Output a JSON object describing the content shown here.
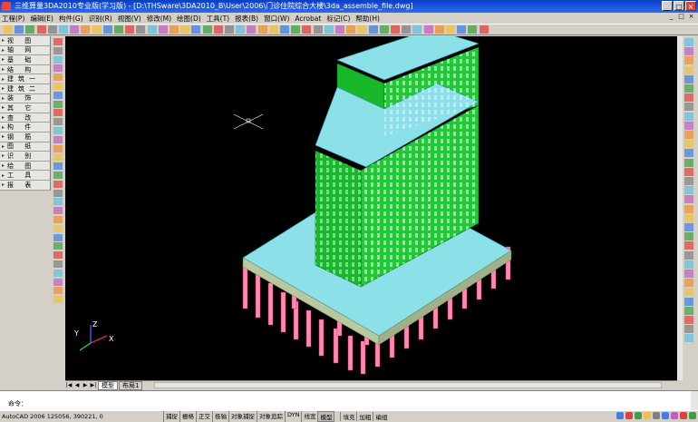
{
  "window": {
    "title": "三维算量3DA2010专业版(学习版) - [D:\\THSware\\3DA2010_B\\User\\2006\\门诊住院综合大楼\\3da_assemble_file.dwg]",
    "minimize": "_",
    "maximize": "□",
    "close": "×"
  },
  "menu": [
    "工程(P)",
    "编辑(E)",
    "构件(G)",
    "识别(R)",
    "视图(V)",
    "修改(M)",
    "绘图(D)",
    "工具(T)",
    "报表(B)",
    "窗口(W)",
    "Acrobat",
    "标记(C)",
    "帮助(H)"
  ],
  "menu_right": [
    "_",
    "□",
    "×"
  ],
  "left_menu": [
    "视  图",
    "轴  网",
    "基  础",
    "结  构",
    "建筑一",
    "建筑二",
    "装  饰",
    "其  它",
    "查  改",
    "构  件",
    "钢  筋",
    "图  纸",
    "识  别",
    "绘  图",
    "工  具",
    "报  表"
  ],
  "tabs": {
    "nav": [
      "|◀",
      "◀",
      "▶",
      "▶|"
    ],
    "items": [
      "模型",
      "布局1"
    ]
  },
  "ucs": {
    "z": "Z",
    "y": "Y",
    "x": "X"
  },
  "command": {
    "prompt": "命令："
  },
  "status": {
    "coords": "AutoCAD 2006  125056,  390221,  0",
    "buttons": [
      "捕捉",
      "栅格",
      "正交",
      "极轴",
      "对象捕捉",
      "对象追踪",
      "DYN",
      "线宽",
      "模型"
    ],
    "active": [
      "模型"
    ],
    "right_labels": [
      "填充",
      "加粗",
      "编组"
    ]
  },
  "colors": {
    "canvas": "#000000",
    "slab": "#8ce0e8",
    "walls": "#18b82a",
    "piles": "#ff8ab0",
    "base": "#b8c8a0"
  }
}
